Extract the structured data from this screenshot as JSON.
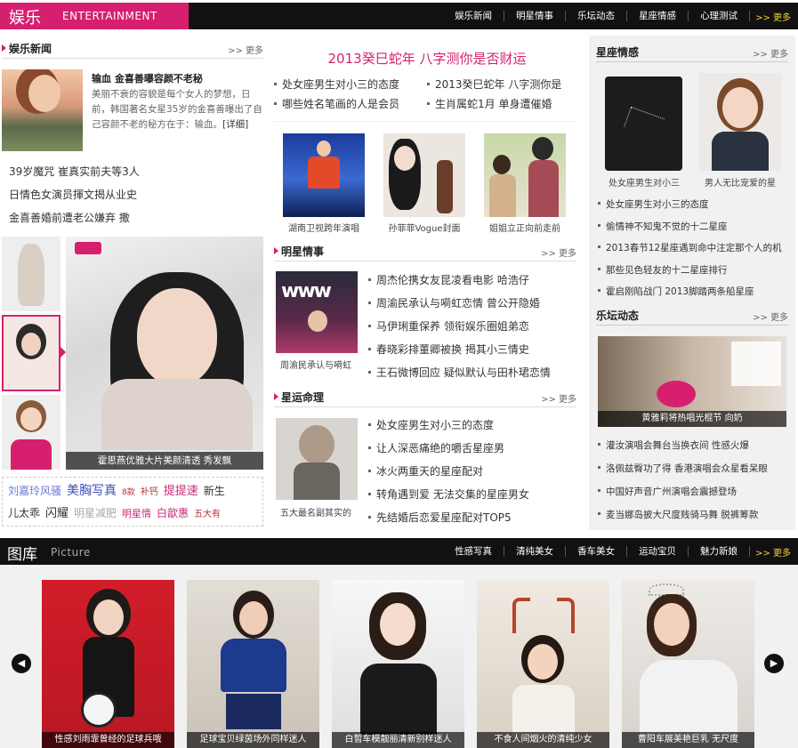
{
  "header": {
    "logo_cn": "娱乐",
    "logo_en": "ENTERTAINMENT",
    "nav": [
      "娱乐新闻",
      "明星情事",
      "乐坛动态",
      "星座情感",
      "心理测试"
    ],
    "more": "更多"
  },
  "yule_news": {
    "title": "娱乐新闻",
    "more": "更多",
    "lead_title": "输血 金喜善曝容颜不老秘",
    "lead_desc": "美丽不衰的容貌是每个女人的梦想，日前，韩国著名女星35岁的金喜善曝出了自己容颜不老的秘方在于：输血。",
    "lead_detail": "[详细]",
    "items": [
      "39岁魔咒 崔真实前夫等3人",
      "日情色女演员揮文揭从业史",
      "金喜善婚前遭老公嫌弃 撒"
    ]
  },
  "gallery_main": {
    "caption": "霍思燕优雅大片美颜清透 秀发飘"
  },
  "tags": [
    {
      "t": "刘嘉玲风骚",
      "c": "#6b7bd0",
      "s": 12
    },
    {
      "t": "美胸写真",
      "c": "#3b4fb8",
      "s": 14
    },
    {
      "t": "8款",
      "c": "#b33",
      "s": 9
    },
    {
      "t": "补钙",
      "c": "#b33",
      "s": 10
    },
    {
      "t": "提提速",
      "c": "#c72a78",
      "s": 13
    },
    {
      "t": "新生",
      "c": "#333",
      "s": 12
    },
    {
      "t": "儿太乖",
      "c": "#333",
      "s": 12
    },
    {
      "t": "闪耀",
      "c": "#333",
      "s": 13
    },
    {
      "t": "明星减肥",
      "c": "#aaa",
      "s": 12
    },
    {
      "t": "明星情",
      "c": "#c72a78",
      "s": 11
    },
    {
      "t": "白歆惠",
      "c": "#c72a78",
      "s": 12
    },
    {
      "t": "五大有",
      "c": "#b33",
      "s": 10
    }
  ],
  "center_top": {
    "headline": "2013癸巳蛇年 八字测你是否财运",
    "links": [
      [
        "处女座男生对小三的态度",
        "2013癸巳蛇年 八字测你是"
      ],
      [
        "哪些姓名笔画的人是会员",
        "生肖属蛇1月 单身遭催婚"
      ]
    ]
  },
  "center_photos": [
    "湖南卫视跨年演唱",
    "孙菲菲Vogue封面",
    "姐姐立正向前走前"
  ],
  "star_affairs": {
    "title": "明星情事",
    "more": "更多",
    "photo_caption": "周渝民承认与嗬虹",
    "items": [
      "周杰伦携女友昆凌看电影 哈浩仔",
      "周渝民承认与嗬虹恋情 曾公开隐婚",
      "马伊琍重保养 领衔娱乐圈姐弟恋",
      "春晓彩排董卿被换 揭其小三情史",
      "王石微博回应 疑似默认与田朴珺恋情"
    ]
  },
  "fortune": {
    "title": "星运命理",
    "more": "更多",
    "photo_caption": "五大最名副其实的",
    "items": [
      "处女座男生对小三的态度",
      "让人深恶痛绝的嚼舌星座男",
      "冰火两重天的星座配对",
      "转角遇到爱 无法交集的星座男女",
      "先结婚后恋爱星座配对TOP5"
    ]
  },
  "constellation": {
    "title": "星座情感",
    "more": "更多",
    "photos": [
      "处女座男生对小三",
      "男人无比宠爱的星"
    ],
    "items": [
      "处女座男生对小三的态度",
      "偷情神不知鬼不觉的十二星座",
      "2013春节12星座遇到命中注定那个人的机",
      "那些见色轻友的十二星座排行",
      "霍启刚陷战门 2013脚踏两条船星座"
    ]
  },
  "music": {
    "title": "乐坛动态",
    "more": "更多",
    "photo_caption": "黄雅莉将热唱光棍节 向奶",
    "items": [
      "灌汝演唱会舞台当换衣间 性感火爆",
      "洛佩兹臀功了得 香港演唱会众星看呆眼",
      "中国好声音广州演唱会震撼登场",
      "麦当娜岛披大尺度贱骑马舞 脱裤筹款"
    ]
  },
  "picture": {
    "cn": "图库",
    "en": "Picture",
    "nav": [
      "性感写真",
      "清纯美女",
      "香车美女",
      "运动宝贝",
      "魅力新娘"
    ],
    "more": "更多",
    "captions": [
      "性感刘雨霏曾经的足球兵哦",
      "足球宝贝绿茵场外同样迷人",
      "白皙车模靓丽清新别样迷人",
      "不食人间烟火的清纯少女",
      "曹阳车展美艳巨乳 无尺度"
    ]
  },
  "colors": {
    "accent": "#d6206f",
    "bar": "#111111",
    "more": "#f4d23c"
  }
}
